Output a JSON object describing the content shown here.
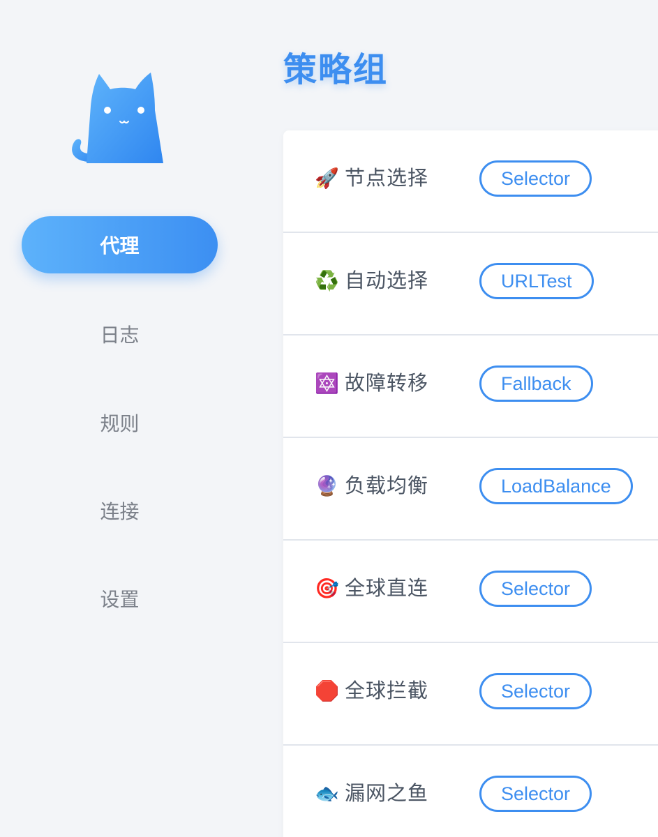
{
  "sidebar": {
    "logo_icon": "cat-logo-icon",
    "items": [
      {
        "label": "代理",
        "active": true
      },
      {
        "label": "日志",
        "active": false
      },
      {
        "label": "规则",
        "active": false
      },
      {
        "label": "连接",
        "active": false
      },
      {
        "label": "设置",
        "active": false
      }
    ]
  },
  "main": {
    "title": "策略组",
    "groups": [
      {
        "emoji": "🚀",
        "icon": "rocket-icon",
        "name": "节点选择",
        "type": "Selector"
      },
      {
        "emoji": "♻️",
        "icon": "recycle-icon",
        "name": "自动选择",
        "type": "URLTest"
      },
      {
        "emoji": "🔯",
        "icon": "star-of-david-icon",
        "name": "故障转移",
        "type": "Fallback"
      },
      {
        "emoji": "🔮",
        "icon": "crystal-ball-icon",
        "name": "负载均衡",
        "type": "LoadBalance"
      },
      {
        "emoji": "🎯",
        "icon": "target-icon",
        "name": "全球直连",
        "type": "Selector"
      },
      {
        "emoji": "🛑",
        "icon": "stop-sign-icon",
        "name": "全球拦截",
        "type": "Selector"
      },
      {
        "emoji": "🐟",
        "icon": "fish-icon",
        "name": "漏网之鱼",
        "type": "Selector"
      }
    ]
  },
  "colors": {
    "accent": "#3d8ef0",
    "background": "#f3f5f8",
    "card": "#ffffff",
    "text": "#4b5563",
    "muted": "#7b8089"
  }
}
